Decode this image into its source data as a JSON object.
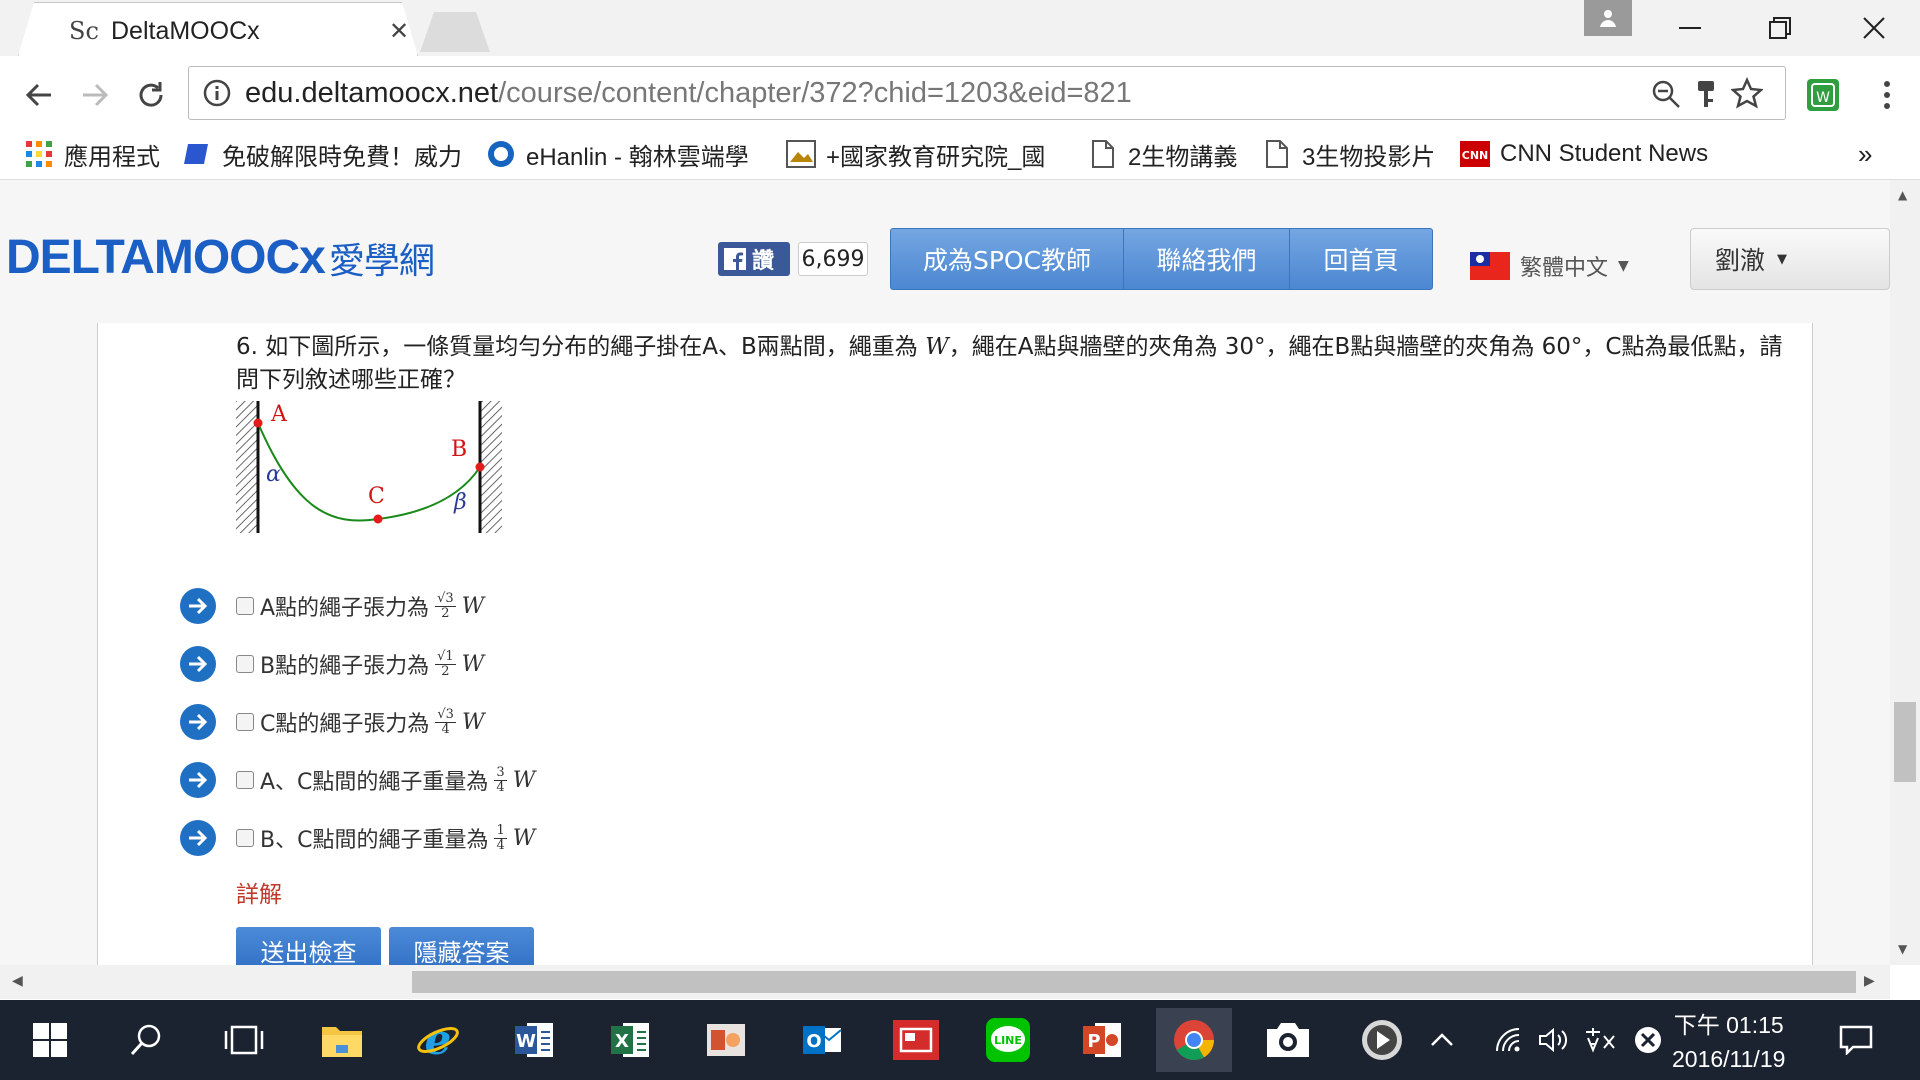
{
  "browser": {
    "tab_title": "DeltaMOOCx",
    "favicon_text": "Sc",
    "url_host": "edu.deltamoocx.net",
    "url_path": "/course/content/chapter/372?chid=1203&eid=821"
  },
  "bookmarks": [
    {
      "label": "應用程式",
      "icon": "apps-grid-icon"
    },
    {
      "label": "免破解限時免費！威力",
      "icon": "blue-bookmark-icon"
    },
    {
      "label": "eHanlin - 翰林雲端學",
      "icon": "ehanlin-icon"
    },
    {
      "label": "+國家教育研究院_國",
      "icon": "image-icon"
    },
    {
      "label": "2生物講義",
      "icon": "document-icon"
    },
    {
      "label": "3生物投影片",
      "icon": "document-icon"
    },
    {
      "label": "CNN Student News",
      "icon": "cnn-icon"
    }
  ],
  "site": {
    "logo_main": "DELTAMOOCx",
    "logo_sub": "愛學網",
    "fb_like_label": "讚",
    "fb_like_count": "6,699",
    "nav": [
      "成為SPOC教師",
      "聯絡我們",
      "回首頁"
    ],
    "language": "繁體中文",
    "user_name": "劉澈"
  },
  "question": {
    "number": "6.",
    "text_before_w": "如下圖所示，一條質量均勻分布的繩子掛在A、B兩點間，繩重為",
    "weight_symbol": "W",
    "text_after_w": "，繩在A點與牆壁的夾角為 30°，繩在B點與牆壁的夾角為 60°，C點為最低點，請問下列敘述哪些正確？",
    "figure_labels": {
      "a": "A",
      "b": "B",
      "c": "C",
      "alpha": "α",
      "beta": "β"
    },
    "options": [
      {
        "text": "A點的繩子張力為",
        "frac_num": "√3",
        "frac_den": "2",
        "var": "W"
      },
      {
        "text": "B點的繩子張力為",
        "frac_num": "√1",
        "frac_den": "2",
        "var": "W"
      },
      {
        "text": "C點的繩子張力為",
        "frac_num": "√3",
        "frac_den": "4",
        "var": "W"
      },
      {
        "text": "A、C點間的繩子重量為",
        "frac_num": "3",
        "frac_den": "4",
        "var": "W"
      },
      {
        "text": "B、C點間的繩子重量為",
        "frac_num": "1",
        "frac_den": "4",
        "var": "W"
      }
    ],
    "detail_link": "詳解",
    "submit_button": "送出檢查",
    "hide_button": "隱藏答案"
  },
  "taskbar": {
    "time": "下午 01:15",
    "date": "2016/11/19"
  },
  "colors": {
    "nav_blue": "#4c87d2",
    "link_red": "#c0392b",
    "rope_green": "#1a8a1a",
    "taskbar_bg": "#1c2330"
  }
}
